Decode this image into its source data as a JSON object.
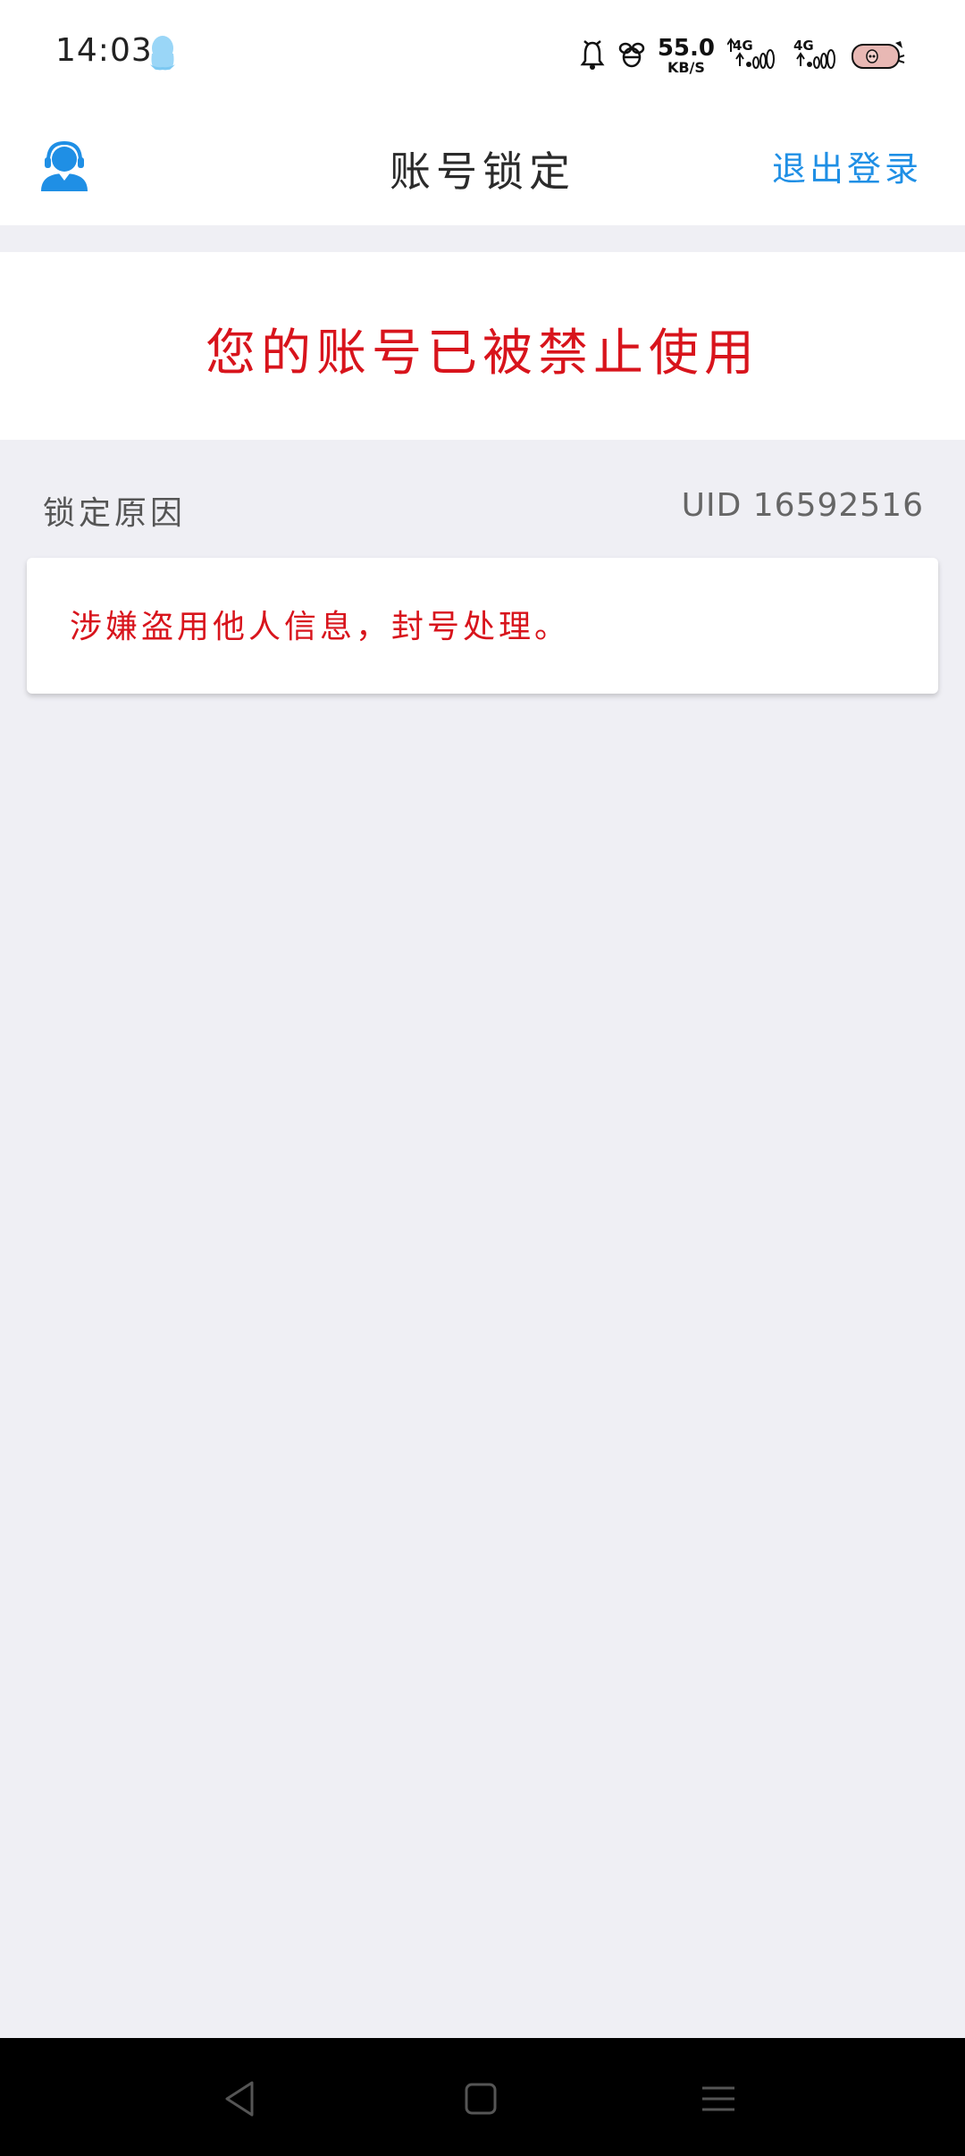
{
  "status_bar": {
    "time": "14:03",
    "speed_value": "55.0",
    "speed_unit": "KB/S",
    "signal1_label": "4G",
    "signal2_label": "4G",
    "icons": [
      "qq-icon",
      "alarm-icon",
      "bee-icon",
      "data-arrows-icon",
      "signal-icon",
      "signal-icon",
      "battery-icon"
    ]
  },
  "header": {
    "title": "账号锁定",
    "logout_label": "退出登录",
    "support_icon": "customer-service-icon"
  },
  "banner": {
    "message": "您的账号已被禁止使用"
  },
  "reason": {
    "label": "锁定原因",
    "uid": "UID 16592516",
    "text": "涉嫌盗用他人信息，封号处理。"
  },
  "colors": {
    "accent": "#1f8fe5",
    "alert_red": "#d8141c",
    "page_bg": "#efeff4"
  },
  "navbar": {
    "icons": [
      "back-icon",
      "home-icon",
      "menu-icon"
    ]
  }
}
